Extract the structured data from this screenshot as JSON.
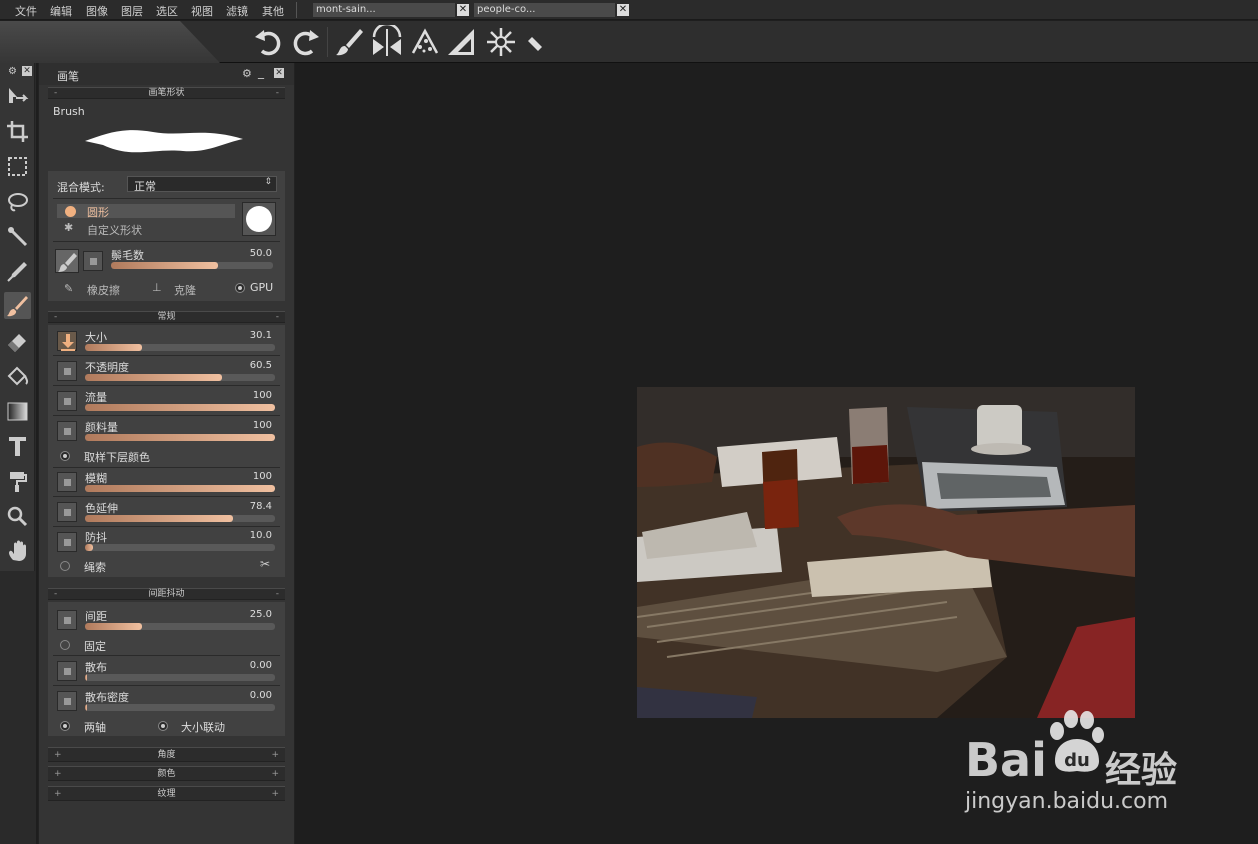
{
  "menubar": {
    "items": [
      "文件",
      "编辑",
      "图像",
      "图层",
      "选区",
      "视图",
      "滤镜",
      "其他"
    ],
    "tabs": [
      {
        "label": "mont-sain..."
      },
      {
        "label": "people-co..."
      }
    ]
  },
  "toolbar": {
    "icons": [
      "undo-icon",
      "redo-icon",
      "brush-icon",
      "symmetry-icon",
      "particles-icon",
      "ruler-triangle-icon",
      "snowflake-icon",
      "small-ruler-icon"
    ]
  },
  "tools": [
    "move-icon",
    "crop-icon",
    "rect-select-icon",
    "lasso-icon",
    "magic-wand-icon",
    "eyedropper-icon",
    "brush-icon",
    "eraser-icon",
    "fill-icon",
    "gradient-icon",
    "text-icon",
    "clone-stamp-icon",
    "zoom-icon",
    "hand-icon"
  ],
  "panel": {
    "title": "画笔",
    "brush_shape_section": "画笔形状",
    "brush_label": "Brush",
    "blend_label": "混合模式:",
    "blend_value": "正常",
    "shape_round": "圆形",
    "shape_custom": "自定义形状",
    "bristles_label": "鬃毛数",
    "bristles_value": "50.0",
    "bristles_fraction": 0.66,
    "eraser_label": "橡皮擦",
    "clone_label": "克隆",
    "gpu_label": "GPU",
    "general_section": "常规",
    "general": [
      {
        "label": "大小",
        "value": "30.1",
        "fraction": 0.3
      },
      {
        "label": "不透明度",
        "value": "60.5",
        "fraction": 0.72
      },
      {
        "label": "流量",
        "value": "100",
        "fraction": 1.0
      },
      {
        "label": "颜料量",
        "value": "100",
        "fraction": 1.0
      }
    ],
    "sample_label": "取样下层颜色",
    "general2": [
      {
        "label": "模糊",
        "value": "100",
        "fraction": 1.0
      },
      {
        "label": "色延伸",
        "value": "78.4",
        "fraction": 0.78
      },
      {
        "label": "防抖",
        "value": "10.0",
        "fraction": 0.04
      }
    ],
    "rope_label": "绳索",
    "jitter_section": "间距抖动",
    "spacing": {
      "label": "间距",
      "value": "25.0",
      "fraction": 0.3
    },
    "fixed_label": "固定",
    "scatter": {
      "label": "散布",
      "value": "0.00",
      "fraction": 0.01
    },
    "scatter_density": {
      "label": "散布密度",
      "value": "0.00",
      "fraction": 0.01
    },
    "axis_label": "两轴",
    "size_link_label": "大小联动",
    "angle_section": "角度",
    "color_section": "颜色",
    "texture_section": "纹理"
  },
  "watermark": {
    "brand_text_1": "Bai",
    "brand_text_2": "经验",
    "url": "jingyan.baidu.com"
  }
}
